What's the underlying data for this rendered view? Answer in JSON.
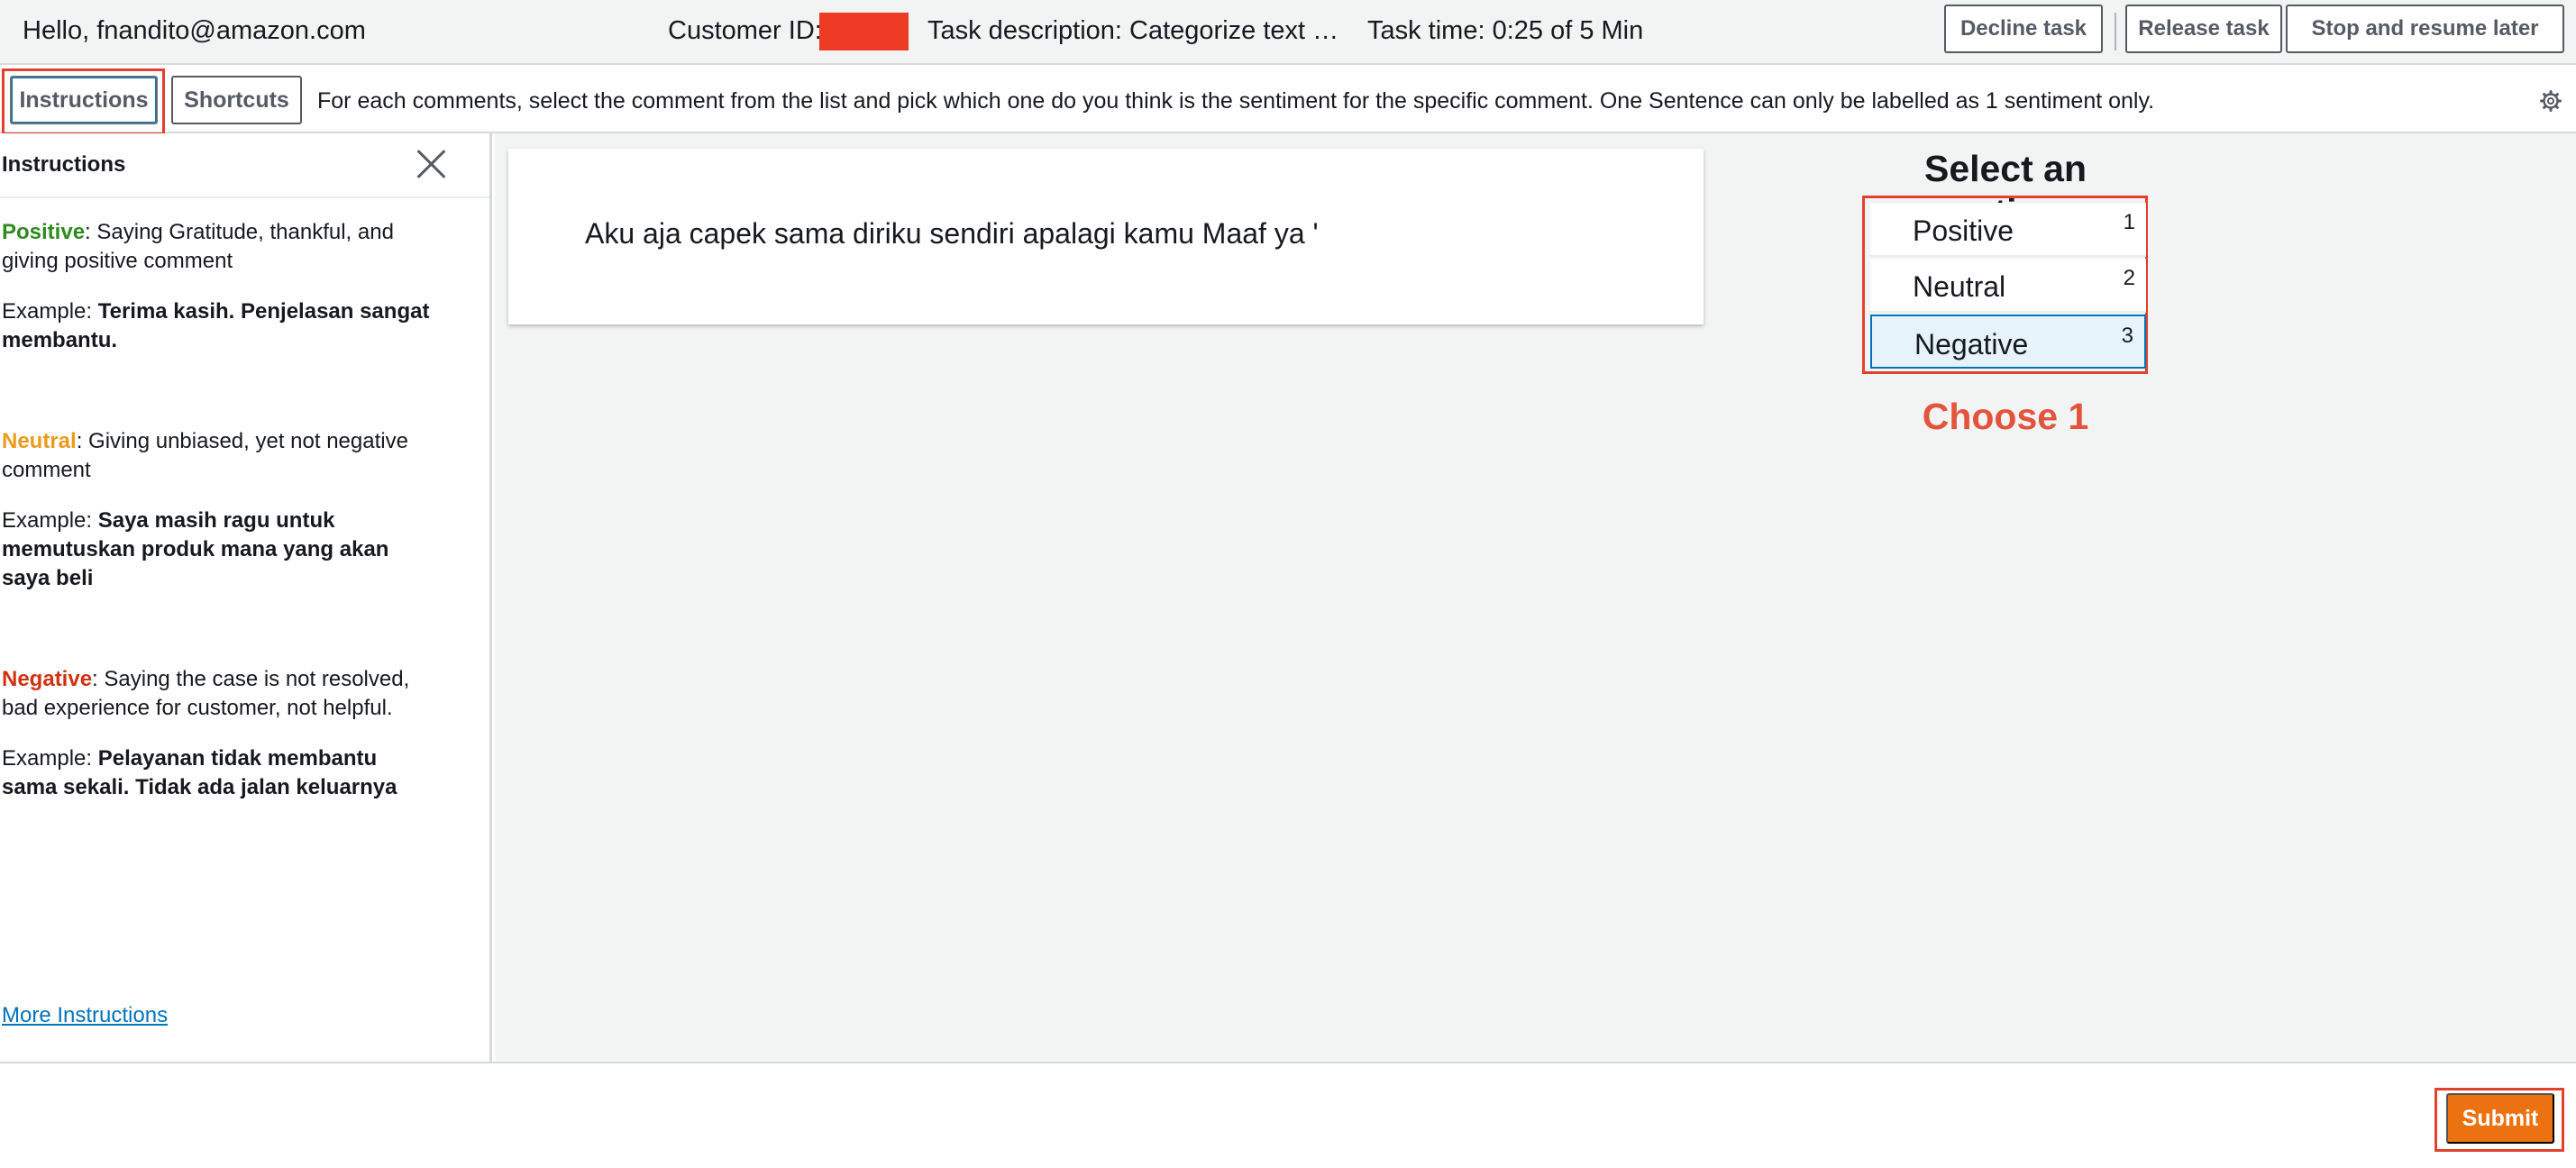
{
  "header": {
    "greeting": "Hello, fnandito@amazon.com",
    "customer_id_label": "Customer ID:",
    "task_description": "Task description: Categorize text …",
    "task_time": "Task time: 0:25 of 5 Min",
    "buttons": {
      "decline": "Decline task",
      "release": "Release task",
      "stop": "Stop and resume later"
    }
  },
  "toolbar": {
    "instructions_tab": "Instructions",
    "shortcuts_tab": "Shortcuts",
    "instruction_line": "For each comments, select the comment from the list and pick which one do you think is the sentiment for the specific comment. One Sentence can only be labelled as 1 sentiment only."
  },
  "left_panel": {
    "title": "Instructions",
    "sections": [
      {
        "word": "Positive",
        "description": ": Saying Gratitude, thankful, and giving positive comment",
        "example_label": "Example: ",
        "example": "Terima kasih. Penjelasan sangat membantu."
      },
      {
        "word": "Neutral",
        "description": ": Giving unbiased, yet not negative comment",
        "example_label": "Example: ",
        "example": "Saya masih ragu untuk memutuskan produk mana yang akan saya beli"
      },
      {
        "word": "Negative",
        "description": ": Saying the case is not resolved, bad experience for customer, not helpful.",
        "example_label": "Example: ",
        "example": "Pelayanan tidak membantu sama sekali. Tidak ada jalan keluarnya"
      }
    ],
    "more_link": "More Instructions"
  },
  "main": {
    "comment_text": "Aku aja capek sama diriku sendiri apalagi kamu Maaf ya '",
    "select_title": "Select an option",
    "options": [
      {
        "label": "Positive",
        "shortcut": "1",
        "selected": false
      },
      {
        "label": "Neutral",
        "shortcut": "2",
        "selected": false
      },
      {
        "label": "Negative",
        "shortcut": "3",
        "selected": true
      }
    ],
    "choose_note": "Choose 1"
  },
  "footer": {
    "submit_label": "Submit"
  },
  "colors": {
    "accent_orange": "#ec7211",
    "annotation_red": "#e4402c",
    "positive_green": "#2e8b1e",
    "neutral_orange": "#ec9a1b",
    "negative_red": "#d13212",
    "link_blue": "#0073bb"
  },
  "icons": {
    "settings": "gear-icon",
    "close": "close-icon"
  }
}
